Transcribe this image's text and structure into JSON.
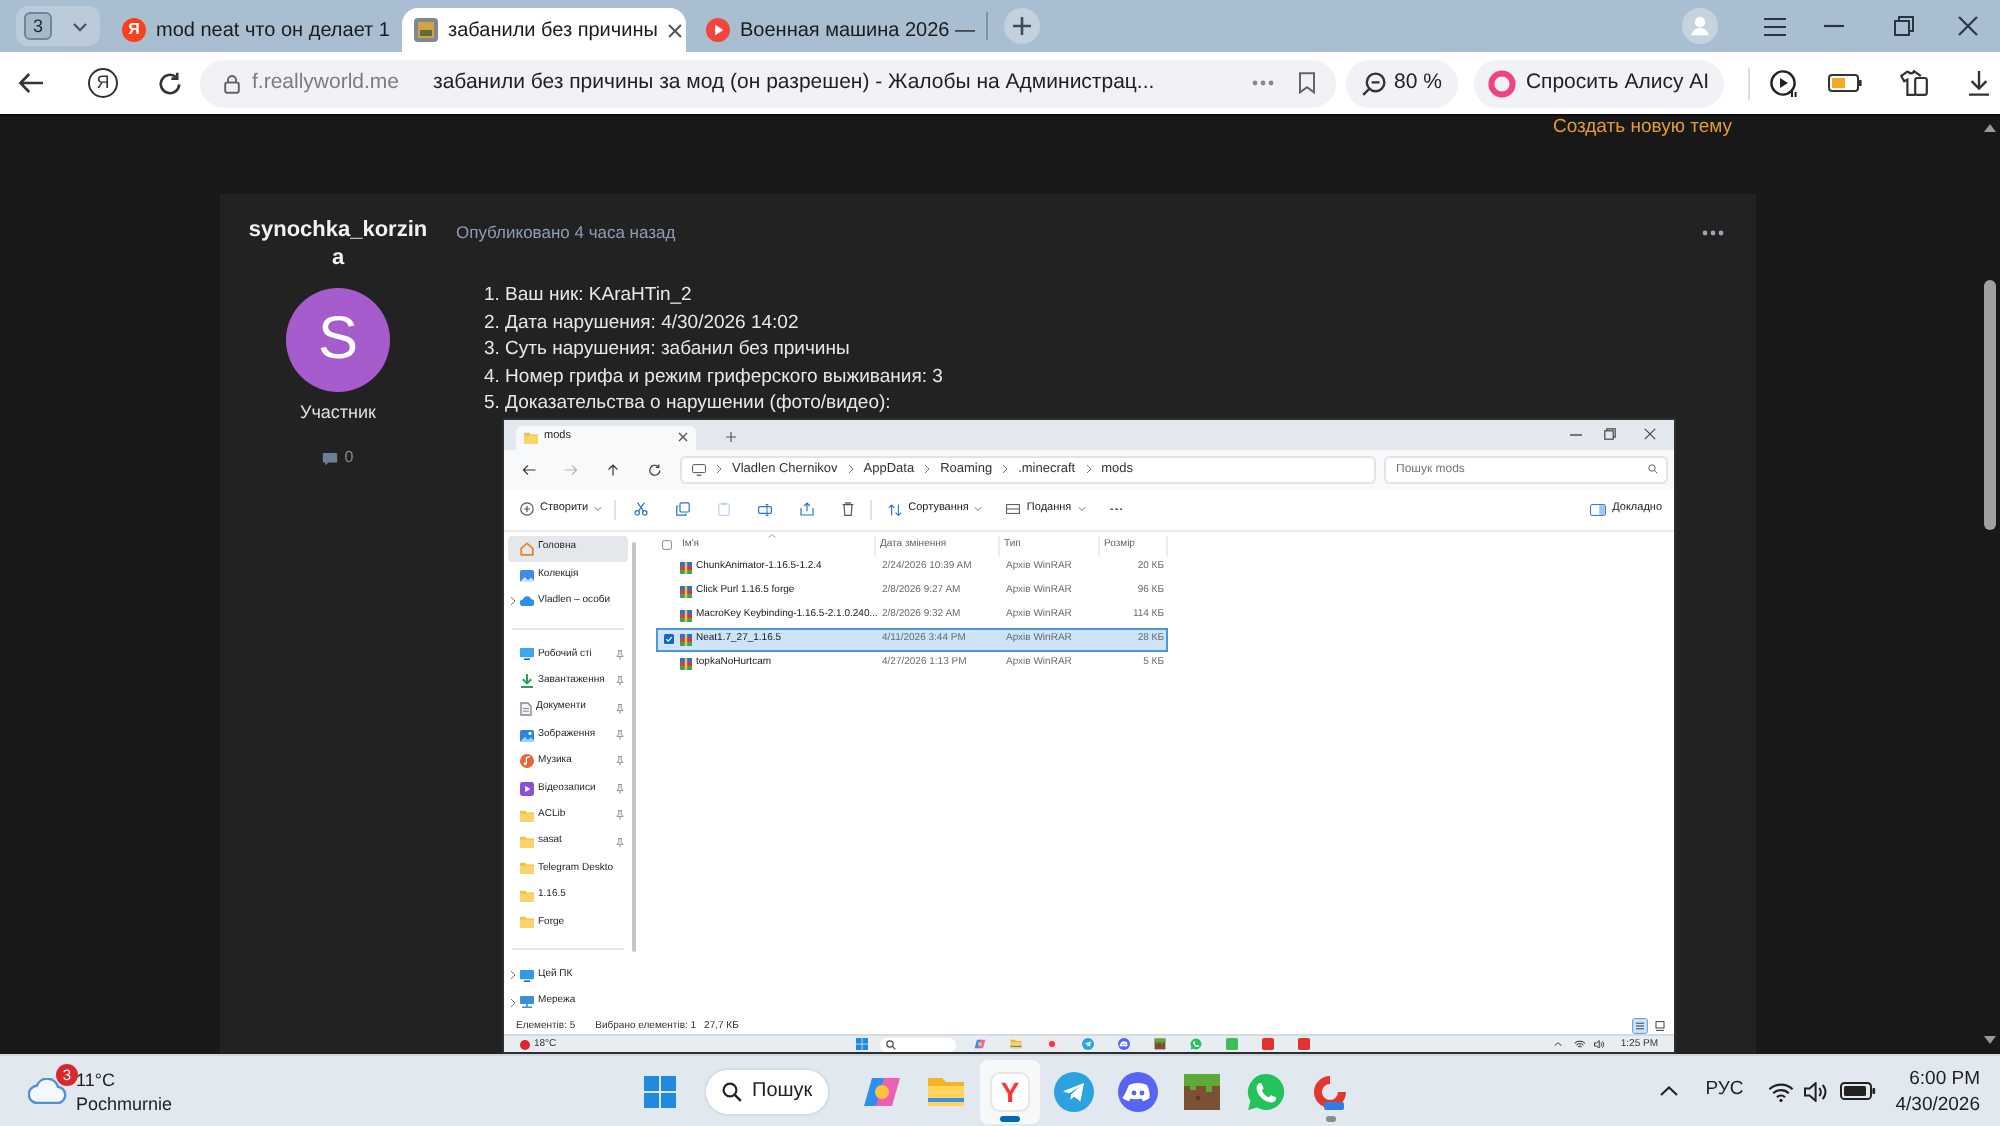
{
  "browser": {
    "tab_counter": "3",
    "tabs": [
      {
        "kind": "search",
        "favicon_letter": "Я",
        "title": "mod neat что он делает 1",
        "selected": false
      },
      {
        "kind": "forum",
        "title": "забанили без причины",
        "selected": true
      },
      {
        "kind": "video",
        "title": "Военная машина 2026 —",
        "selected": false
      }
    ],
    "toolbar": {
      "home_letter": "Я",
      "domain": "f.reallyworld.me",
      "page_title": "забанили без причины за мод (он разрешен) - Жалобы на Администрац...",
      "zoom": "80 %",
      "assistant": "Спросить Алису AI"
    }
  },
  "page": {
    "create_topic": "Создать новую тему"
  },
  "post": {
    "author": "synochka_korzina",
    "avatar_letter": "S",
    "role": "Участник",
    "reactions": "0",
    "posted": "Опубликовано 4 часа назад",
    "lines": [
      "1. Ваш ник: KAraHTin_2",
      "2. Дата нарушения: 4/30/2026 14:02",
      "3. Суть нарушения: забанил без причины",
      "4. Номер грифа и режим гриферского выживания: 3",
      "5. Доказательства о нарушении (фото/видео):"
    ]
  },
  "attachment": {
    "window": {
      "tab": "mods",
      "nav_buttons": [
        {
          "kind": "back",
          "disabled": false
        },
        {
          "kind": "forward",
          "disabled": true
        },
        {
          "kind": "up",
          "disabled": false
        },
        {
          "kind": "reload",
          "disabled": false
        }
      ],
      "path": [
        "Vladlen Chernikov",
        "AppData",
        "Roaming",
        ".minecraft",
        "mods"
      ],
      "search_placeholder": "Пошук mods"
    },
    "commands": {
      "new": "Створити",
      "sort": "Сортування",
      "view": "Подання",
      "details": "Докладно"
    },
    "actions": [
      {
        "kind": "cut",
        "disabled": false
      },
      {
        "kind": "copy",
        "disabled": false
      },
      {
        "kind": "paste",
        "disabled": true
      },
      {
        "kind": "rename",
        "disabled": false
      },
      {
        "kind": "share",
        "disabled": false
      },
      {
        "kind": "delete",
        "disabled": false
      }
    ],
    "nav": [
      [
        {
          "label": "Головна",
          "kind": "home",
          "selected": true,
          "pinned": false,
          "expandable": false
        },
        {
          "label": "Колекція",
          "kind": "gallery",
          "selected": false,
          "pinned": false,
          "expandable": false
        },
        {
          "label": "Vladlen – особи",
          "kind": "cloud",
          "selected": false,
          "pinned": false,
          "expandable": true
        }
      ],
      [
        {
          "label": "Робочий сті",
          "kind": "desktop",
          "selected": false,
          "pinned": true,
          "expandable": false
        },
        {
          "label": "Завантаження",
          "kind": "downloads",
          "selected": false,
          "pinned": true,
          "expandable": false
        },
        {
          "label": "Документи",
          "kind": "documents",
          "selected": false,
          "pinned": true,
          "expandable": false
        },
        {
          "label": "Зображення",
          "kind": "pictures",
          "selected": false,
          "pinned": true,
          "expandable": false
        },
        {
          "label": "Музика",
          "kind": "music",
          "selected": false,
          "pinned": true,
          "expandable": false
        },
        {
          "label": "Відеозаписи",
          "kind": "videos",
          "selected": false,
          "pinned": true,
          "expandable": false
        },
        {
          "label": "ACLib",
          "kind": "folder",
          "selected": false,
          "pinned": true,
          "expandable": false
        },
        {
          "label": "sasat",
          "kind": "folder",
          "selected": false,
          "pinned": true,
          "expandable": false
        },
        {
          "label": "Telegram Deskto",
          "kind": "folder",
          "selected": false,
          "pinned": false,
          "expandable": false
        },
        {
          "label": "1.16.5",
          "kind": "folder",
          "selected": false,
          "pinned": false,
          "expandable": false
        },
        {
          "label": "Forge",
          "kind": "folder",
          "selected": false,
          "pinned": false,
          "expandable": false
        }
      ],
      [
        {
          "label": "Цей ПК",
          "kind": "pc",
          "selected": false,
          "pinned": false,
          "expandable": true
        },
        {
          "label": "Мережа",
          "kind": "network",
          "selected": false,
          "pinned": false,
          "expandable": true
        }
      ]
    ],
    "columns": {
      "name": "Ім'я",
      "modified": "Дата змінення",
      "type": "Тип",
      "size": "Розмір"
    },
    "select_all": false,
    "files": [
      {
        "name": "ChunkAnimator-1.16.5-1.2.4",
        "modified": "2/24/2026 10:39 AM",
        "type": "Архів WinRAR",
        "size": "20 КБ",
        "selected": false
      },
      {
        "name": "Click Purl 1.16.5 forge",
        "modified": "2/8/2026 9:27 AM",
        "type": "Архів WinRAR",
        "size": "96 КБ",
        "selected": false
      },
      {
        "name": "MacroKey Keybinding-1.16.5-2.1.0.240...",
        "modified": "2/8/2026 9:32 AM",
        "type": "Архів WinRAR",
        "size": "114 КБ",
        "selected": false
      },
      {
        "name": "Neat1.7_27_1.16.5",
        "modified": "4/11/2026 3:44 PM",
        "type": "Архів WinRAR",
        "size": "28 КБ",
        "selected": true
      },
      {
        "name": "topkaNoHurtcam",
        "modified": "4/27/2026 1:13 PM",
        "type": "Архів WinRAR",
        "size": "5 КБ",
        "selected": false
      }
    ],
    "status": {
      "count": "Елементів: 5",
      "selection": "Вибрано елементів: 1",
      "selection_size": "27,7 КБ"
    },
    "views": [
      {
        "kind": "details",
        "selected": true
      },
      {
        "kind": "tiles",
        "selected": false
      }
    ],
    "taskbar": {
      "temperature": "18°C",
      "apps": [
        {
          "kind": "copilot"
        },
        {
          "kind": "explorer"
        },
        {
          "kind": "yandex"
        },
        {
          "kind": "telegram"
        },
        {
          "kind": "discord"
        },
        {
          "kind": "minecraft"
        },
        {
          "kind": "whatsapp"
        },
        {
          "kind": "tile",
          "color": "#3fbf5a"
        },
        {
          "kind": "tile",
          "color": "#e0332f"
        },
        {
          "kind": "tile",
          "color": "#e0332f"
        }
      ],
      "time": "1:25 PM"
    }
  },
  "taskbar": {
    "weather": {
      "badge": "3",
      "temperature": "11°C",
      "condition": "Pochmurnie"
    },
    "search": "Пошук",
    "apps": [
      {
        "kind": "copilot",
        "selected": false,
        "running": false
      },
      {
        "kind": "explorer",
        "selected": false,
        "running": false
      },
      {
        "kind": "yandex",
        "letter": "Y",
        "selected": true,
        "running": true
      },
      {
        "kind": "telegram",
        "selected": false,
        "running": false
      },
      {
        "kind": "discord",
        "selected": false,
        "running": false
      },
      {
        "kind": "minecraft",
        "selected": false,
        "running": false
      },
      {
        "kind": "whatsapp",
        "selected": false,
        "running": false
      },
      {
        "kind": "swirl",
        "selected": false,
        "running": true
      }
    ],
    "tray": {
      "language": "РУС",
      "time": "6:00 PM",
      "date": "4/30/2026"
    }
  }
}
